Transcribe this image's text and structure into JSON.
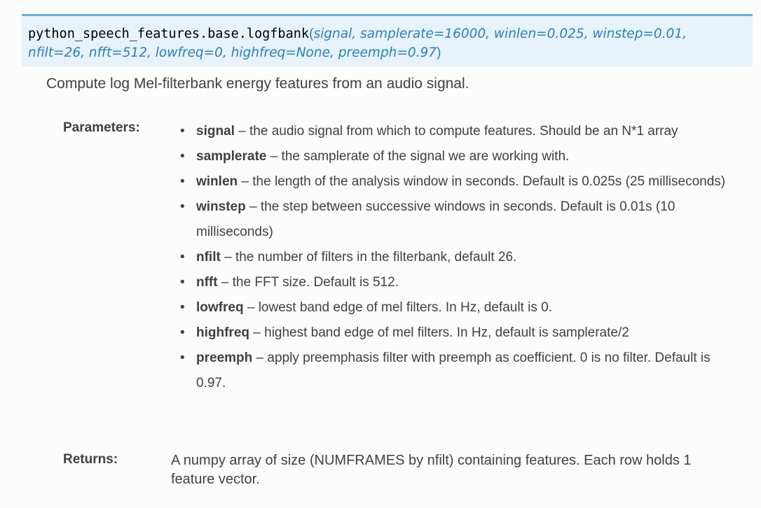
{
  "signature": {
    "module": "python_speech_features.base.",
    "name": "logfbank",
    "open_paren": "(",
    "params_line1": "signal, samplerate=16000, winlen=0.025, winstep=0.01,",
    "params_line2": "nfilt=26, nfft=512, lowfreq=0, highfreq=None, preemph=0.97",
    "close_paren": ")"
  },
  "description": "Compute log Mel-filterbank energy features from an audio signal.",
  "parameters_label": "Parameters:",
  "parameters": [
    {
      "name": "signal",
      "sep": " – ",
      "text": "the audio signal from which to compute features. Should be an N*1 array"
    },
    {
      "name": "samplerate",
      "sep": " – ",
      "text": "the samplerate of the signal we are working with."
    },
    {
      "name": "winlen",
      "sep": " – ",
      "text": "the length of the analysis window in seconds. Default is 0.025s (25 milliseconds)"
    },
    {
      "name": "winstep",
      "sep": " – ",
      "text": "the step between successive windows in seconds. Default is 0.01s (10 milliseconds)"
    },
    {
      "name": "nfilt",
      "sep": " – ",
      "text": "the number of filters in the filterbank, default 26."
    },
    {
      "name": "nfft",
      "sep": " – ",
      "text": "the FFT size. Default is 512."
    },
    {
      "name": "lowfreq",
      "sep": " – ",
      "text": "lowest band edge of mel filters. In Hz, default is 0."
    },
    {
      "name": "highfreq",
      "sep": " – ",
      "text": "highest band edge of mel filters. In Hz, default is samplerate/2"
    },
    {
      "name": "preemph",
      "sep": " – ",
      "text": "apply preemphasis filter with preemph as coefficient. 0 is no filter. Default is 0.97."
    }
  ],
  "returns_label": "Returns:",
  "returns_text": "A numpy array of size (NUMFRAMES by nfilt) containing features. Each row holds 1 feature vector."
}
